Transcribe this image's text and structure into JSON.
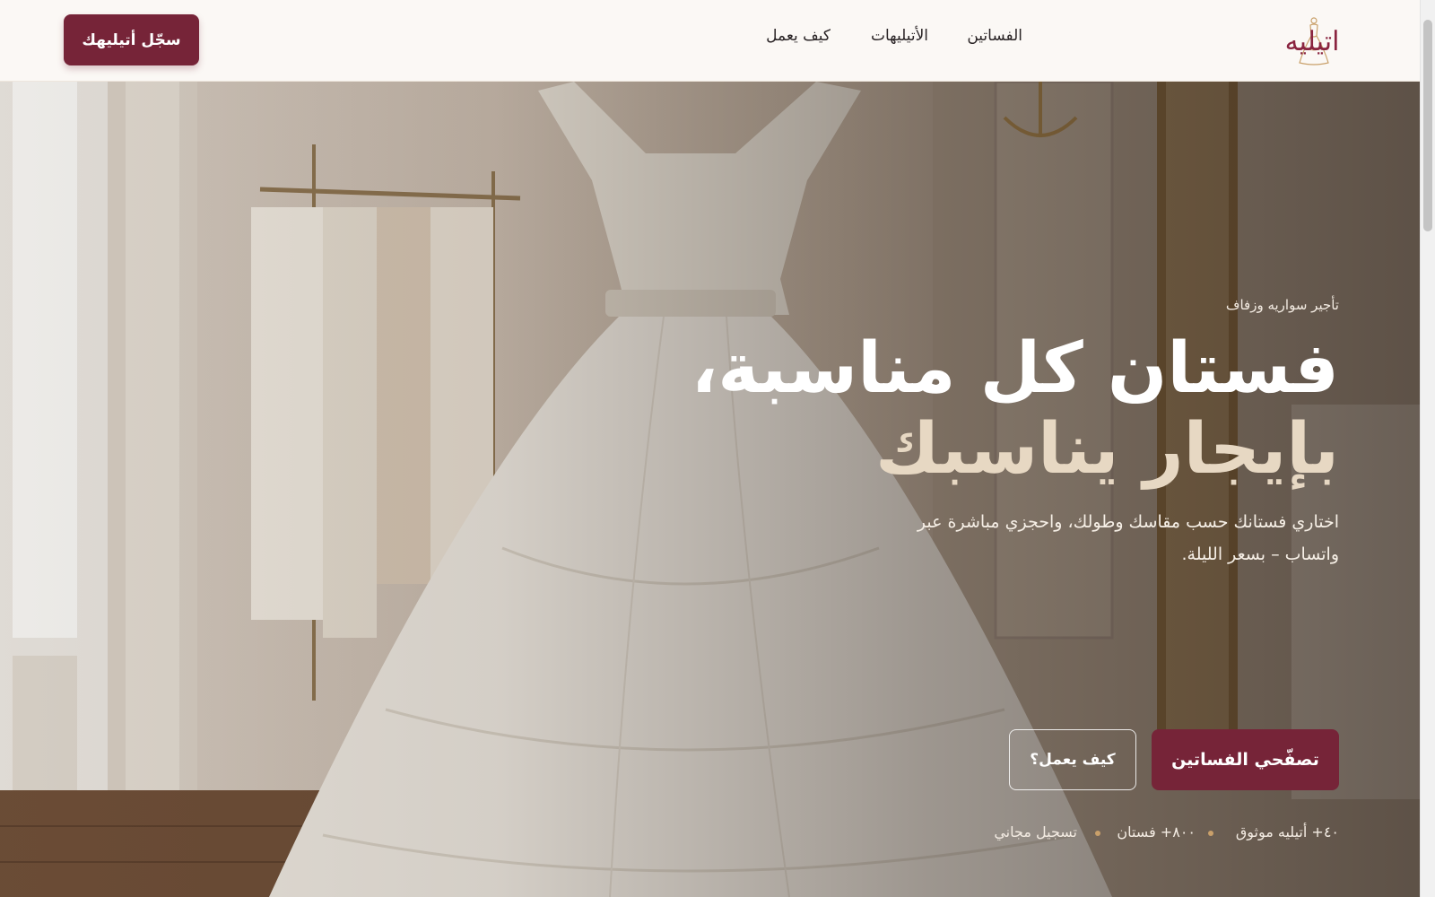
{
  "brand": {
    "logo_text": "اتيليه",
    "accent": "#762438",
    "gold": "#c9a06a"
  },
  "nav": {
    "items": [
      {
        "label": "الفساتين"
      },
      {
        "label": "الأتيليهات"
      },
      {
        "label": "كيف يعمل"
      }
    ],
    "register_label": "سجّل أتيليهك"
  },
  "hero": {
    "eyebrow": "تأجير سواريه وزفاف",
    "title_line1": "فستان كل مناسبة،",
    "title_line2": "بإيجار يناسبك",
    "subtitle": "اختاري فستانك حسب مقاسك وطولك، واحجزي مباشرة عبر واتساب – بسعر الليلة.",
    "primary_cta": "تصفّحي الفساتين",
    "secondary_cta": "كيف يعمل؟",
    "stats": [
      {
        "label": "٤٠+ أتيليه موثوق"
      },
      {
        "label": "٨٠٠+ فستان"
      },
      {
        "label": "تسجيل مجاني"
      }
    ]
  },
  "icons": {
    "logo": "dress-logo-icon",
    "stat_separator": "dot-icon"
  }
}
